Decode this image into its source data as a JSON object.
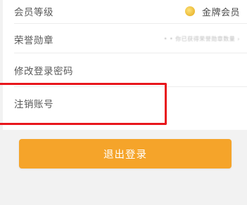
{
  "settings": {
    "member_level": {
      "label": "会员等级",
      "value": "金牌会员",
      "icon": "medal-icon"
    },
    "honor_badges": {
      "label": "荣誉勋章",
      "value": "•  • 你已获得荣誉勋章数量 ›"
    },
    "change_password": {
      "label": "修改登录密码"
    },
    "cancel_account": {
      "label": "注销账号"
    }
  },
  "logout_button": {
    "label": "退出登录"
  },
  "colors": {
    "accent": "#f5a42a",
    "highlight": "#e8161c"
  }
}
